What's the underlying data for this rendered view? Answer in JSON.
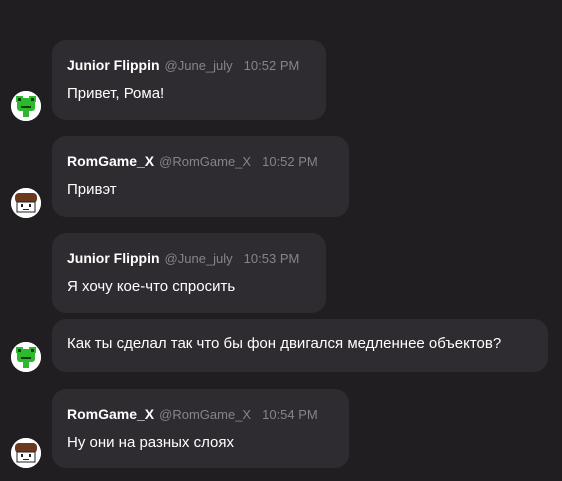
{
  "messages": [
    {
      "author": "Junior Flippin",
      "handle": "@June_july",
      "time": "10:52 PM",
      "text": "Привет, Рома!",
      "avatar": "green-frog-avatar"
    },
    {
      "author": "RomGame_X",
      "handle": "@RomGame_X",
      "time": "10:52 PM",
      "text": "Привэт",
      "avatar": "brown-hair-face-avatar"
    },
    {
      "author": "Junior Flippin",
      "handle": "@June_july",
      "time": "10:53 PM",
      "text": "Я хочу кое-что спросить",
      "avatar": "green-frog-avatar"
    },
    {
      "text": "Как ты сделал так что бы фон двигался медленнее объектов?",
      "avatar": "green-frog-avatar"
    },
    {
      "author": "RomGame_X",
      "handle": "@RomGame_X",
      "time": "10:54 PM",
      "text": "Ну они на разных слоях",
      "avatar": "brown-hair-face-avatar"
    }
  ],
  "colors": {
    "background": "#201e21",
    "bubble": "#2e2c30",
    "text": "#ffffff",
    "meta": "#86848a",
    "frog": "#2eb82e",
    "hair": "#6b3a1e"
  }
}
